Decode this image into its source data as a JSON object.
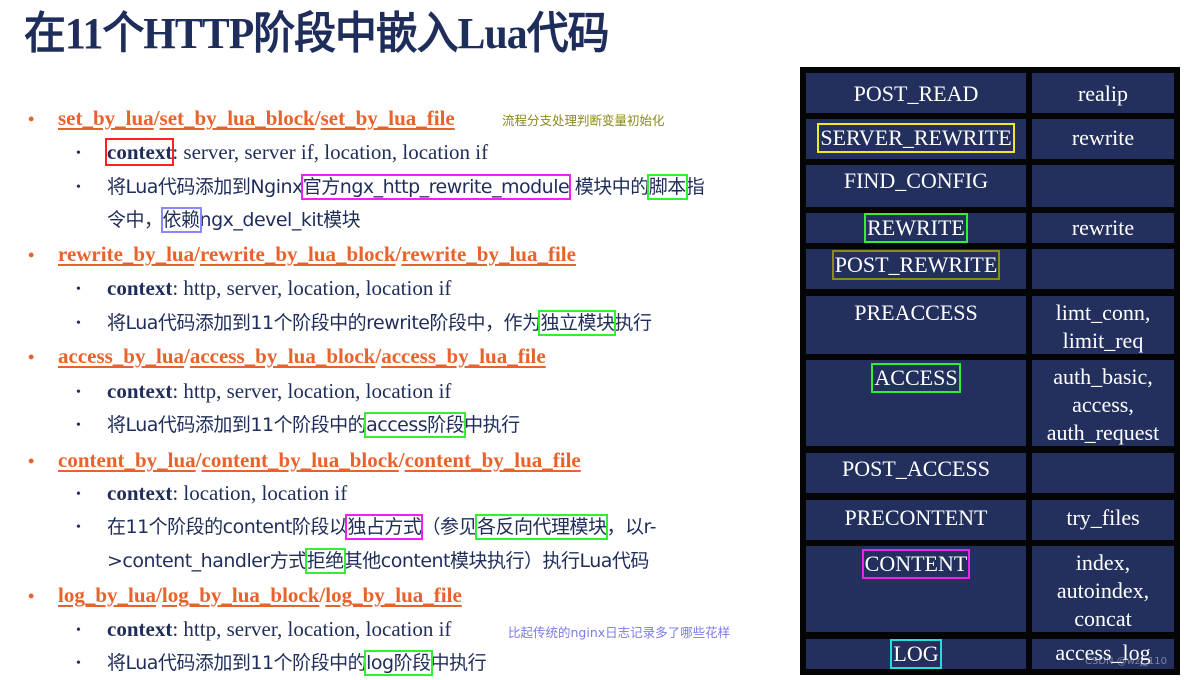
{
  "title": "在11个HTTP阶段中嵌入Lua代码",
  "colors": {
    "title": "#1f2d5a",
    "directive": "#e8622c",
    "body_text": "#1f2d5a",
    "table_cell_bg": "#23305e",
    "table_border": "#050505",
    "note_olive": "#8a8a1a",
    "note_purple": "#7b7be8"
  },
  "sections": [
    {
      "directives": [
        "set_by_lua",
        "set_by_lua_block",
        "set_by_lua_file"
      ],
      "note": "流程分支处理判断变量初始化",
      "context_label": "context",
      "context_value": ": server, server if, location, location if",
      "desc": {
        "p1": "将Lua代码添加到Nginx",
        "h1": "官方ngx_http_rewrite_module",
        "p2": " 模块中的",
        "h2": "脚本",
        "p3": "指",
        "line2_p1": "令中，",
        "line2_h1": "依赖",
        "line2_p2": "ngx_devel_kit模块"
      }
    },
    {
      "directives": [
        "rewrite_by_lua",
        "rewrite_by_lua_block",
        "rewrite_by_lua_file"
      ],
      "context_label": "context",
      "context_value": ": http, server, location, location if",
      "desc": {
        "p1": "将Lua代码添加到11个阶段中的rewrite阶段中，作为",
        "h1": "独立模块",
        "p2": "执行"
      }
    },
    {
      "directives": [
        "access_by_lua",
        "access_by_lua_block",
        "access_by_lua_file"
      ],
      "context_label": "context",
      "context_value": ": http, server, location, location if",
      "desc": {
        "p1": "将Lua代码添加到11个阶段中的",
        "h1": "access阶段",
        "p2": "中执行"
      }
    },
    {
      "directives": [
        "content_by_lua",
        "content_by_lua_block",
        "content_by_lua_file"
      ],
      "context_label": "context",
      "context_value": ": location, location if",
      "desc": {
        "p1": "在11个阶段的content阶段以",
        "h1": "独占方式",
        "p2": "（参见",
        "h2": "各反向代理模块",
        "p3": "，以r-",
        "line2_p1": ">content_handler方式",
        "line2_h1": "拒绝",
        "line2_p2": "其他content模块执行）执行Lua代码"
      }
    },
    {
      "directives": [
        "log_by_lua",
        "log_by_lua_block",
        "log_by_lua_file"
      ],
      "note": "比起传统的nginx日志记录多了哪些花样",
      "context_label": "context",
      "context_value": ": http, server, location, location if",
      "desc": {
        "p1": "将Lua代码添加到11个阶段中的",
        "h1": "log阶段",
        "p2": "中执行"
      }
    }
  ],
  "bullet": "•",
  "slash": "/",
  "phases_table": {
    "rows": [
      {
        "phase": "POST_READ",
        "modules": [
          "realip"
        ]
      },
      {
        "phase": "SERVER_REWRITE",
        "modules": [
          "rewrite"
        ]
      },
      {
        "phase": "FIND_CONFIG",
        "modules": []
      },
      {
        "phase": "REWRITE",
        "modules": [
          "rewrite"
        ]
      },
      {
        "phase": "POST_REWRITE",
        "modules": []
      },
      {
        "phase": "PREACCESS",
        "modules": [
          "limt_conn,",
          "limit_req"
        ]
      },
      {
        "phase": "ACCESS",
        "modules": [
          "auth_basic,",
          "access,",
          "auth_request"
        ]
      },
      {
        "phase": "POST_ACCESS",
        "modules": []
      },
      {
        "phase": "PRECONTENT",
        "modules": [
          "try_files"
        ]
      },
      {
        "phase": "CONTENT",
        "modules": [
          "index,",
          "autoindex,",
          "concat"
        ]
      },
      {
        "phase": "LOG",
        "modules": [
          "access_log"
        ]
      }
    ],
    "watermark": "CSDN @wzj_110"
  }
}
